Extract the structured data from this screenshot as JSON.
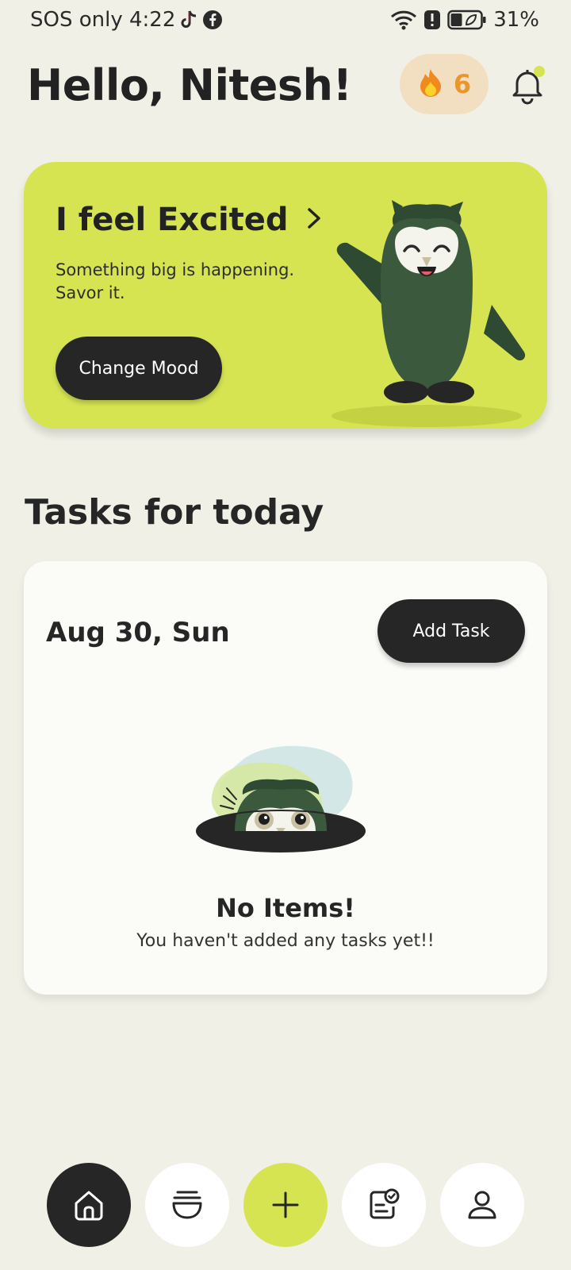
{
  "status_bar": {
    "left_text": "SOS only 4:22",
    "battery": "31%"
  },
  "header": {
    "greeting": "Hello, Nitesh!",
    "streak_count": "6"
  },
  "mood_card": {
    "title": "I feel Excited",
    "description": "Something big is happening. Savor it.",
    "button_label": "Change Mood"
  },
  "tasks": {
    "section_title": "Tasks for today",
    "date": "Aug 30, Sun",
    "add_button_label": "Add Task",
    "empty_title": "No Items!",
    "empty_subtitle": "You haven't added any tasks yet!!"
  },
  "nav": {
    "items": [
      {
        "icon": "home-icon",
        "active": true
      },
      {
        "icon": "pot-icon",
        "active": false
      },
      {
        "icon": "plus-icon",
        "active": false
      },
      {
        "icon": "task-check-icon",
        "active": false
      },
      {
        "icon": "profile-icon",
        "active": false
      }
    ]
  },
  "colors": {
    "background": "#f0f0e7",
    "accent_lime": "#d6e452",
    "dark": "#262626",
    "streak_bg": "#f2dfc2",
    "streak_text": "#e9962c",
    "owl_green": "#3b5a3d"
  }
}
